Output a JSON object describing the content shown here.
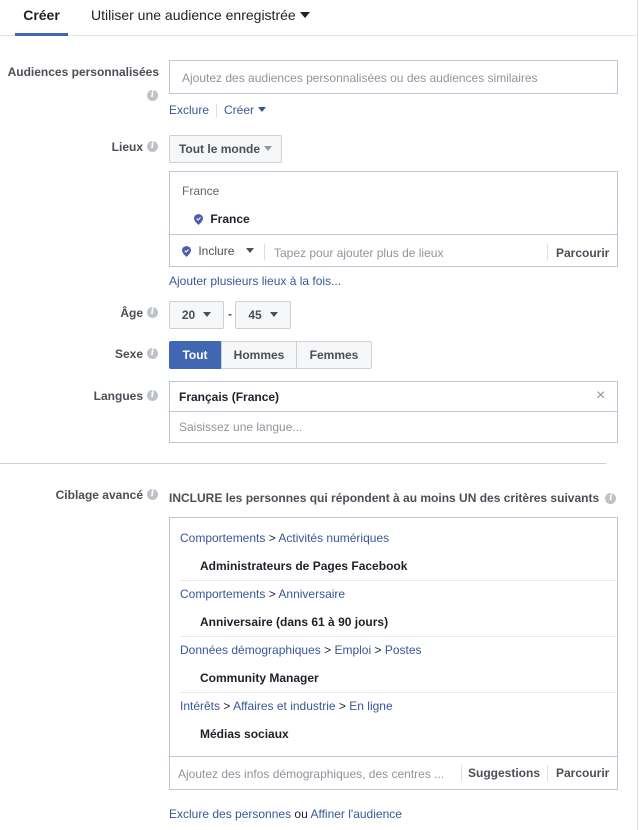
{
  "tabs": {
    "create": "Créer",
    "saved_audience": "Utiliser une audience enregistrée"
  },
  "custom_audiences": {
    "label": "Audiences personnalisées",
    "placeholder": "Ajoutez des audiences personnalisées ou des audiences similaires",
    "exclude_link": "Exclure",
    "create_link": "Créer"
  },
  "locations": {
    "label": "Lieux",
    "dropdown_value": "Tout le monde",
    "group_header": "France",
    "selected_location": "France",
    "include_value": "Inclure",
    "placeholder": "Tapez pour ajouter plus de lieux",
    "browse": "Parcourir",
    "bulk_link": "Ajouter plusieurs lieux à la fois..."
  },
  "age": {
    "label": "Âge",
    "min": "20",
    "separator": "-",
    "max": "45"
  },
  "gender": {
    "label": "Sexe",
    "options": [
      "Tout",
      "Hommes",
      "Femmes"
    ],
    "selected": "Tout"
  },
  "languages": {
    "label": "Langues",
    "selected": "Français (France)",
    "remove_glyph": "×",
    "placeholder": "Saisissez une langue..."
  },
  "detailed_targeting": {
    "label": "Ciblage avancé",
    "include_prefix": "INCLURE",
    "include_text": " les personnes qui répondent à au moins UN des critères suivants",
    "criteria": [
      {
        "path": [
          "Comportements",
          "Activités numériques"
        ],
        "item": "Administrateurs de Pages Facebook"
      },
      {
        "path": [
          "Comportements",
          "Anniversaire"
        ],
        "item": "Anniversaire (dans 61 à 90 jours)"
      },
      {
        "path": [
          "Données démographiques",
          "Emploi",
          "Postes"
        ],
        "item": "Community Manager"
      },
      {
        "path": [
          "Intérêts",
          "Affaires et industrie",
          "En ligne"
        ],
        "item": "Médias sociaux"
      }
    ],
    "path_separator": ">",
    "placeholder": "Ajoutez des infos démographiques, des centres ...",
    "suggestions": "Suggestions",
    "browse": "Parcourir",
    "exclude_link": "Exclure des personnes",
    "or_text": "ou",
    "narrow_link": "Affiner l'audience"
  },
  "colors": {
    "accent": "#4267b2",
    "link": "#365899",
    "border": "#bdc7d8"
  }
}
